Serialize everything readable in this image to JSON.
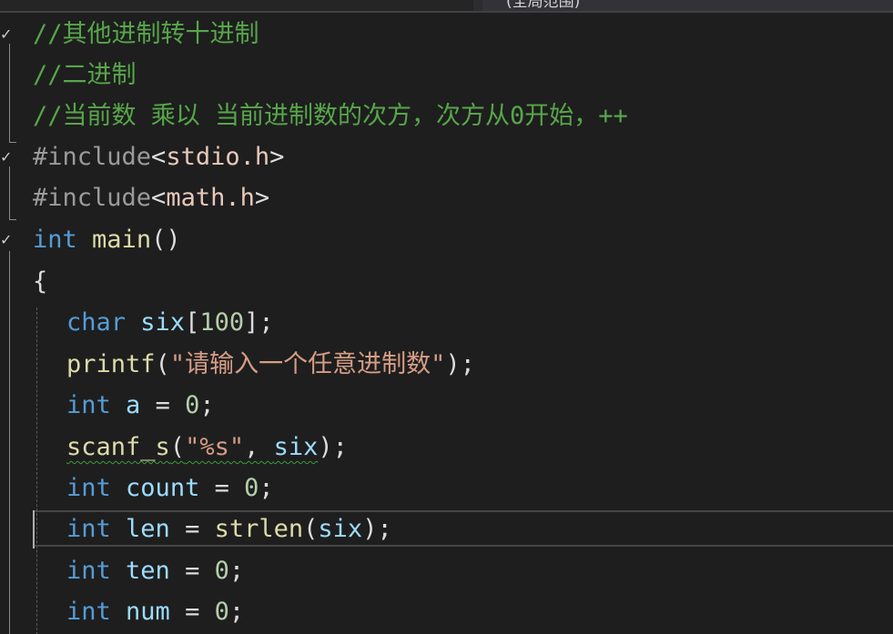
{
  "header": {
    "scope_label": "(全局范围)"
  },
  "gutter": {
    "check_glyph": "✓"
  },
  "code": {
    "comment_1": "//其他进制转十进制",
    "comment_2": "//二进制",
    "comment_3": "//当前数 乘以 当前进制数的次方，次方从0开始，++",
    "include_1": {
      "directive": "#include",
      "lt": "<",
      "header": "stdio.h",
      "gt": ">"
    },
    "include_2": {
      "directive": "#include",
      "lt": "<",
      "header": "math.h",
      "gt": ">"
    },
    "main_decl": {
      "type": "int",
      "name": "main",
      "parens": "()"
    },
    "open_brace": "{",
    "char_decl": {
      "type": "char",
      "name": "six",
      "bracket_open": "[",
      "size": "100",
      "bracket_close": "];"
    },
    "printf_call": {
      "fn": "printf",
      "open": "(",
      "string": "\"请输入一个任意进制数\"",
      "close": ");"
    },
    "int_a": {
      "type": "int",
      "name": "a",
      "assign": " = ",
      "value": "0",
      "end": ";"
    },
    "scanf_call": {
      "fn": "scanf_s",
      "open": "(",
      "string": "\"%s\"",
      "comma": ", ",
      "arg": "six",
      "close": ");"
    },
    "int_count": {
      "type": "int",
      "name": "count",
      "assign": " = ",
      "value": "0",
      "end": ";"
    },
    "int_len": {
      "type": "int",
      "name": "len",
      "assign": " = ",
      "fn": "strlen",
      "open": "(",
      "arg": "six",
      "close": ");"
    },
    "int_ten": {
      "type": "int",
      "name": "ten",
      "assign": " = ",
      "value": "0",
      "end": ";"
    },
    "int_num": {
      "type": "int",
      "name": "num",
      "assign": " = ",
      "value": "0",
      "end": ";"
    }
  },
  "colors": {
    "background": "#1e1e1e",
    "comment": "#57a64a",
    "keyword": "#569cd6",
    "function": "#dcdcaa",
    "identifier": "#9cdcfe",
    "string": "#d69d85",
    "number": "#b5cea8",
    "preprocessor": "#9b9b9b"
  }
}
